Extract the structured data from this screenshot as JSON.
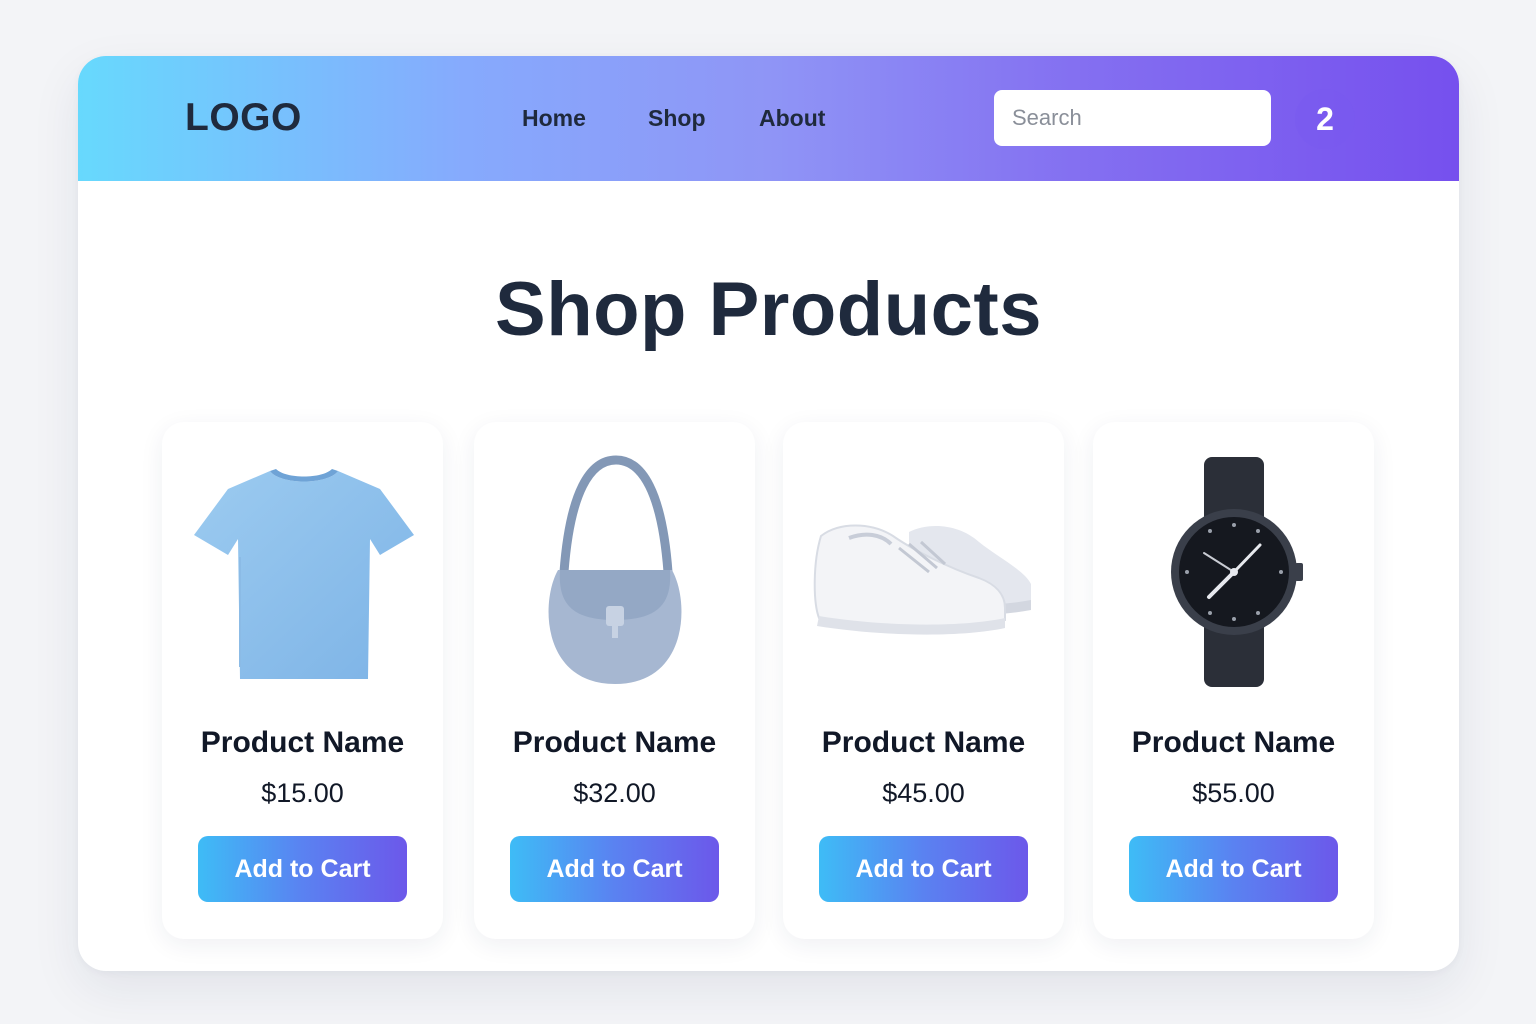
{
  "header": {
    "logo": "LOGO",
    "nav": [
      {
        "label": "Home"
      },
      {
        "label": "Shop"
      },
      {
        "label": "About"
      }
    ],
    "search_placeholder": "Search",
    "cart_count": "2"
  },
  "main": {
    "title": "Shop Products",
    "products": [
      {
        "icon": "t-shirt",
        "name": "Product Name",
        "price": "$15.00",
        "button": "Add to Cart"
      },
      {
        "icon": "handbag",
        "name": "Product Name",
        "price": "$32.00",
        "button": "Add to Cart"
      },
      {
        "icon": "sneakers",
        "name": "Product Name",
        "price": "$45.00",
        "button": "Add to Cart"
      },
      {
        "icon": "wristwatch",
        "name": "Product Name",
        "price": "$55.00",
        "button": "Add to Cart"
      }
    ]
  },
  "colors": {
    "header_gradient_start": "#67d9fd",
    "header_gradient_end": "#7650ee",
    "button_gradient_start": "#3ebcf6",
    "button_gradient_end": "#6c58ea",
    "text_dark": "#1f2a3d"
  }
}
